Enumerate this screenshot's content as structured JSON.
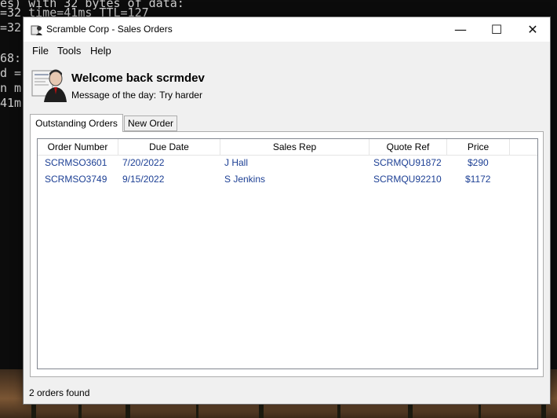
{
  "terminal": {
    "lines": [
      "es) with 32 bytes of data:",
      "=32 time=41ms TTL=127",
      "=32",
      "",
      "68:",
      "d =",
      "n m",
      "41m"
    ]
  },
  "window": {
    "title": "Scramble Corp - Sales Orders",
    "minimize_glyph": "—",
    "maximize_glyph": "☐",
    "close_glyph": "✕"
  },
  "menu": {
    "file": "File",
    "tools": "Tools",
    "help": "Help"
  },
  "header": {
    "welcome": "Welcome back scrmdev",
    "motd_label": "Message of the day:",
    "motd_text": "Try harder"
  },
  "tabs": [
    {
      "label": "Outstanding Orders",
      "active": true
    },
    {
      "label": "New Order",
      "active": false
    }
  ],
  "orders": {
    "columns": [
      "Order Number",
      "Due Date",
      "Sales Rep",
      "Quote Ref",
      "Price"
    ],
    "rows": [
      {
        "order_number": "SCRMSO3601",
        "due_date": "7/20/2022",
        "sales_rep": "J Hall",
        "quote_ref": "SCRMQU91872",
        "price": "$290"
      },
      {
        "order_number": "SCRMSO3749",
        "due_date": "9/15/2022",
        "sales_rep": "S Jenkins",
        "quote_ref": "SCRMQU92210",
        "price": "$1172"
      }
    ]
  },
  "status": {
    "text": "2 orders found"
  },
  "colors": {
    "row_text": "#1c3f94",
    "window_bg": "#f0f0f0"
  }
}
